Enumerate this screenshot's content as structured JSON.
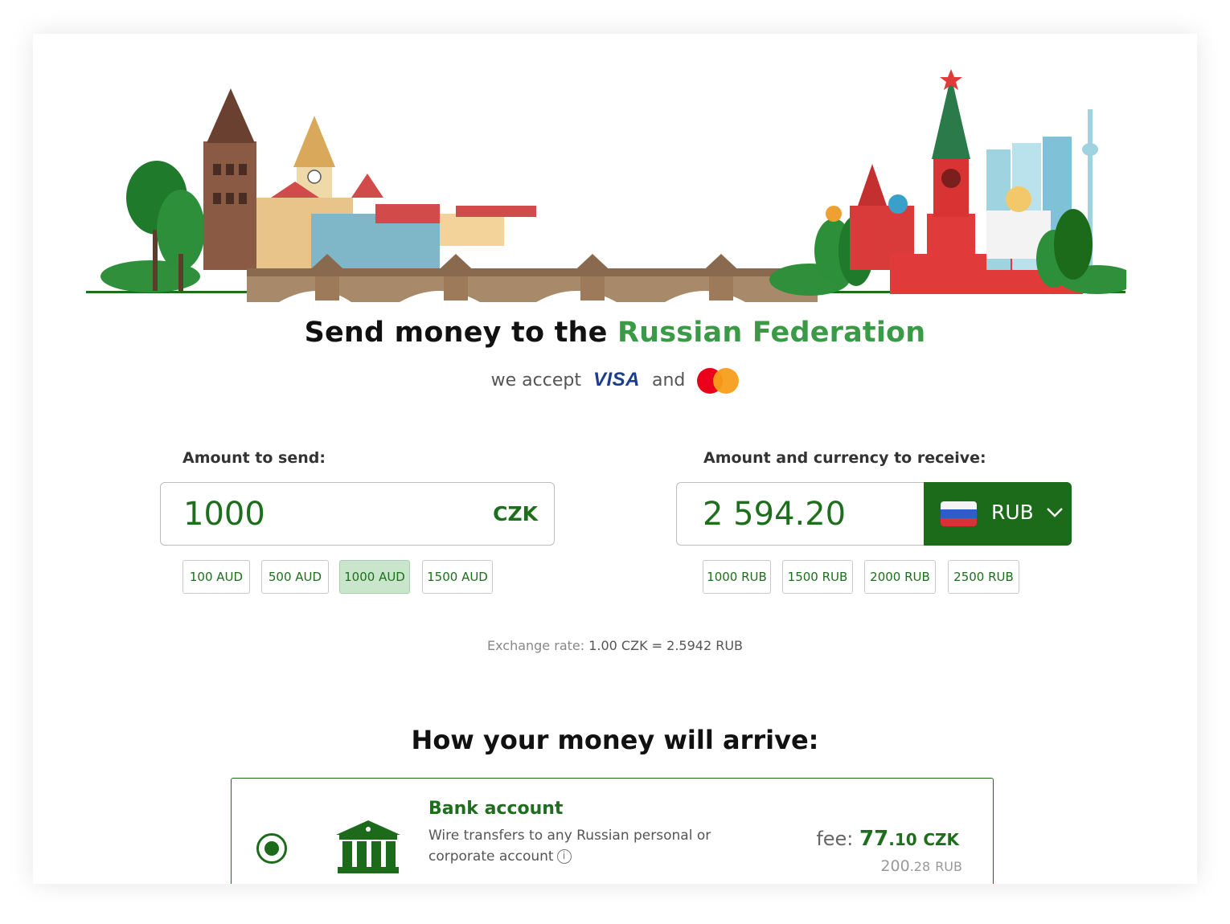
{
  "title": {
    "prefix": "Send money to the",
    "country": "Russian Federation"
  },
  "payment": {
    "text": "we accept",
    "visa": "VISA",
    "and": "and",
    "mastercard_icon": "mastercard-logo"
  },
  "send": {
    "label": "Amount to send:",
    "value": "1000",
    "currency": "CZK",
    "presets": [
      "100 AUD",
      "500 AUD",
      "1000 AUD",
      "1500 AUD"
    ],
    "active_preset": "1000 AUD"
  },
  "receive": {
    "label": "Amount and currency to receive:",
    "value": "2 594.20",
    "currency": "RUB",
    "flag_icon": "russia-flag-icon",
    "presets": [
      "1000 RUB",
      "1500 RUB",
      "2000 RUB",
      "2500 RUB"
    ]
  },
  "rate": {
    "label": "Exchange rate:",
    "value": "1.00 CZK = 2.5942 RUB"
  },
  "delivery": {
    "heading": "How your money will arrive:",
    "option": {
      "title": "Bank account",
      "description": "Wire transfers to any Russian personal or corporate account",
      "fee_label": "fee:",
      "fee_whole": "77",
      "fee_cents": ".10",
      "fee_currency": "CZK",
      "fee_alt_whole": "200",
      "fee_alt_cents": ".28",
      "fee_alt_currency": "RUB",
      "selected": true
    }
  },
  "colors": {
    "accent": "#3a9a45",
    "primary": "#1b6b1b",
    "active_chip": "#c9e6cc"
  }
}
